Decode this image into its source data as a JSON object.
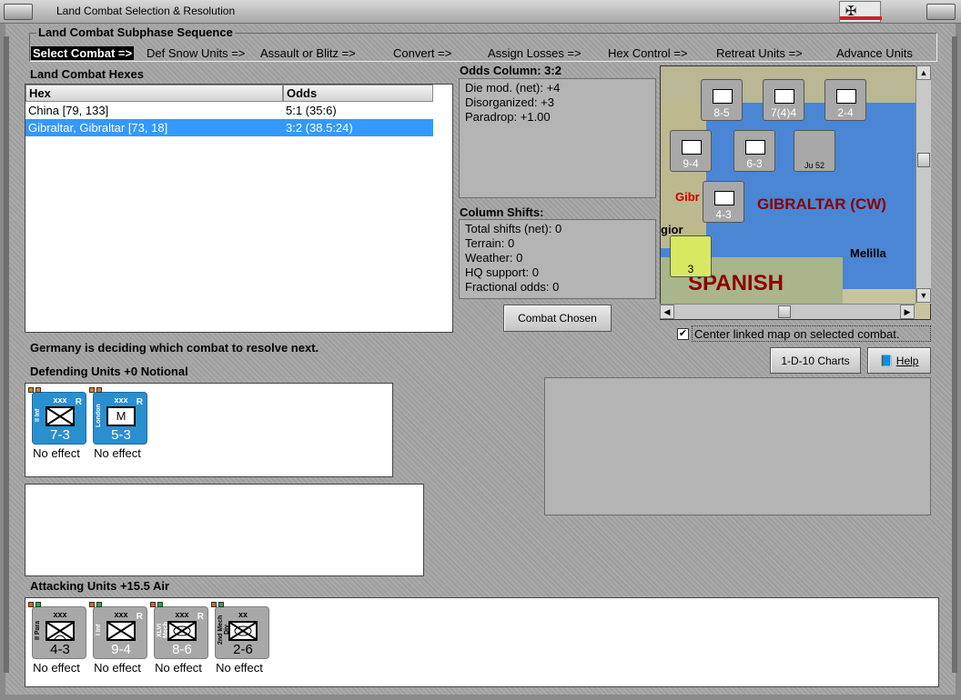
{
  "window": {
    "title": "Land Combat Selection & Resolution"
  },
  "subphase": {
    "title": "Land Combat Subphase Sequence",
    "steps": [
      "Select Combat =>",
      "Def Snow Units =>",
      "Assault or Blitz =>",
      "Convert =>",
      "Assign Losses =>",
      "Hex Control =>",
      "Retreat Units =>",
      "Advance Units"
    ]
  },
  "hexes": {
    "title": "Land Combat Hexes",
    "columns": [
      "Hex",
      "Odds"
    ],
    "rows": [
      {
        "hex": "China [79, 133]",
        "odds": "5:1 (35:6)"
      },
      {
        "hex": "Gibraltar, Gibraltar [73, 18]",
        "odds": "3:2 (38.5:24)"
      }
    ]
  },
  "odds": {
    "title": "Odds Column: 3:2",
    "lines": [
      "Die mod. (net): +4",
      "Disorganized: +3",
      "Paradrop: +1.00"
    ]
  },
  "shifts": {
    "title": "Column Shifts:",
    "lines": [
      "Total shifts (net): 0",
      "Terrain: 0",
      "Weather: 0",
      "HQ support: 0",
      "Fractional odds: 0"
    ]
  },
  "buttons": {
    "combat_chosen": "Combat Chosen",
    "charts": "1-D-10 Charts",
    "help": "Help"
  },
  "map": {
    "labels": {
      "gibraltar": "GIBRALTAR (CW)",
      "melilla": "Melilla",
      "spanish": "SPANISH",
      "gibr": "Gibr",
      "gior": "gior"
    },
    "units": [
      {
        "label": "8-5"
      },
      {
        "label": "7(4)4"
      },
      {
        "label": "2-4"
      },
      {
        "label": "9-4"
      },
      {
        "label": "6-3"
      },
      {
        "label": "Ju 52"
      },
      {
        "label": "4-3"
      },
      {
        "label": "3"
      }
    ],
    "center_linked": "Center linked map on selected combat."
  },
  "status": "Germany is deciding which combat to resolve next.",
  "defending": {
    "title": "Defending Units +0 Notional",
    "units": [
      {
        "name": "II Inf",
        "strength": "7-3",
        "effect": "No effect",
        "size": "xxx",
        "symbol": ""
      },
      {
        "name": "London",
        "strength": "5-3",
        "effect": "No effect",
        "size": "xxx",
        "symbol": "M"
      }
    ]
  },
  "attacking": {
    "title": "Attacking Units +15.5 Air",
    "units": [
      {
        "name": "II Para",
        "strength": "4-3",
        "effect": "No effect",
        "size": "xxx"
      },
      {
        "name": "I Inf",
        "strength": "9-4",
        "effect": "No effect",
        "size": "xxx"
      },
      {
        "name": "XLVI Mech",
        "strength": "8-6",
        "effect": "No effect",
        "size": "xxx"
      },
      {
        "name": "2nd Mech Div",
        "strength": "2-6",
        "effect": "No effect",
        "size": "xx"
      }
    ]
  },
  "colors": {
    "selection": "#3399ff",
    "defender": "#2a8fcf",
    "attacker": "#a8a8a8",
    "map_label": "#8b0000"
  }
}
